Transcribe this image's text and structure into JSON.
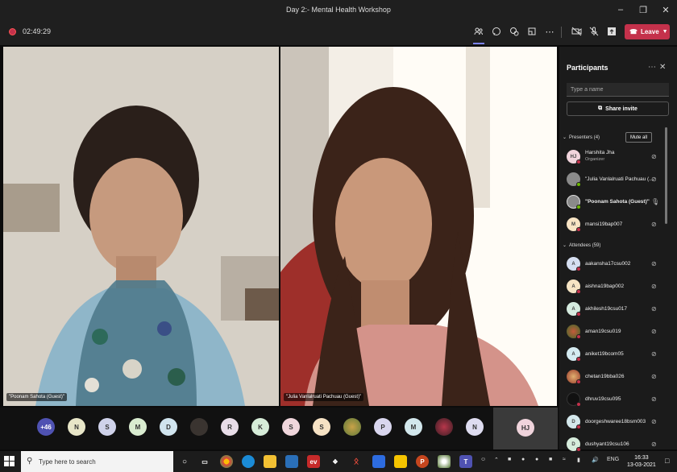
{
  "window": {
    "title": "Day 2:- Mental Health Workshop"
  },
  "toolbar": {
    "timer": "02:49:29",
    "leave_label": "Leave"
  },
  "videos": [
    {
      "name": "\"Poonam Sahota (Guest)\""
    },
    {
      "name": "\"Julia Vanlalruati Pachuau (Guest)\""
    }
  ],
  "strip": {
    "overflow": "+46",
    "avatars": [
      "N",
      "S",
      "M",
      "D",
      "",
      "R",
      "K",
      "S",
      "S",
      "",
      "P",
      "M",
      "",
      "N"
    ],
    "self_initials": "HJ"
  },
  "panel": {
    "title": "Participants",
    "search_placeholder": "Type a name",
    "share_invite": "Share invite",
    "presenters_heading": "Presenters (4)",
    "mute_all": "Mute all",
    "presenters": [
      {
        "initials": "HJ",
        "name": "Harshita Jha",
        "role": "Organizer"
      },
      {
        "initials": "",
        "name": "\"Julia Vanlalruati Pachuau (...",
        "role": ""
      },
      {
        "initials": "",
        "name": "\"Poonam Sahota (Guest)\"",
        "role": ""
      },
      {
        "initials": "M",
        "name": "mansi19bap007",
        "role": ""
      }
    ],
    "attendees_heading": "Attendees (59)",
    "attendees": [
      {
        "initials": "A",
        "name": "aakansha17csu002"
      },
      {
        "initials": "A",
        "name": "aishna19bap002"
      },
      {
        "initials": "A",
        "name": "akhilesh19csu017"
      },
      {
        "initials": "",
        "name": "aman19csu019"
      },
      {
        "initials": "A",
        "name": "aniket19bcom05"
      },
      {
        "initials": "",
        "name": "chetan19bba026"
      },
      {
        "initials": "",
        "name": "dhruv19csu095"
      },
      {
        "initials": "D",
        "name": "doorgeshwaree18bsm003"
      },
      {
        "initials": "D",
        "name": "dushyant19csu106"
      }
    ]
  },
  "taskbar": {
    "search_placeholder": "Type here to search",
    "lang": "ENG",
    "time": "16:33",
    "date": "13-03-2021"
  }
}
